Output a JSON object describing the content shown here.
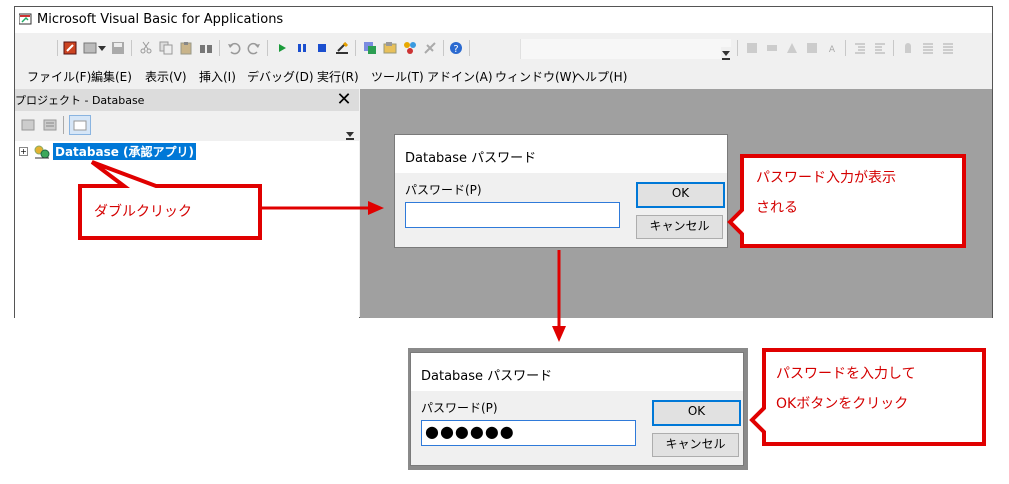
{
  "window": {
    "title": "Microsoft Visual Basic for Applications",
    "icon": "vba-app-icon"
  },
  "menu": [
    {
      "label": "ファイル(F)"
    },
    {
      "label": "編集(E)"
    },
    {
      "label": "表示(V)"
    },
    {
      "label": "挿入(I)"
    },
    {
      "label": "デバッグ(D)"
    },
    {
      "label": "実行(R)"
    },
    {
      "label": "ツール(T)"
    },
    {
      "label": "アドイン(A)"
    },
    {
      "label": "ウィンドウ(W)"
    },
    {
      "label": "ヘルプ(H)"
    }
  ],
  "project": {
    "title": "プロジェクト - Database",
    "close_glyph": "✕",
    "expand_glyph": "+",
    "tree_item": "Database (承認アプリ)"
  },
  "dialog1": {
    "title": "Database パスワード",
    "label": "パスワード(P)",
    "value": "",
    "ok": "OK",
    "cancel": "キャンセル"
  },
  "dialog2": {
    "title": "Database パスワード",
    "label": "パスワード(P)",
    "value": "●●●●●●",
    "ok": "OK",
    "cancel": "キャンセル"
  },
  "annotations": {
    "double_click": "ダブルクリック",
    "password_shown_line1": "パスワード入力が表示",
    "password_shown_line2": "される",
    "enter_password_line1": "パスワードを入力して",
    "enter_password_line2": "OKボタンをクリック"
  },
  "colors": {
    "annotation_red": "#e00000",
    "selection_blue": "#0078d7",
    "mdi_gray": "#a0a0a0"
  }
}
